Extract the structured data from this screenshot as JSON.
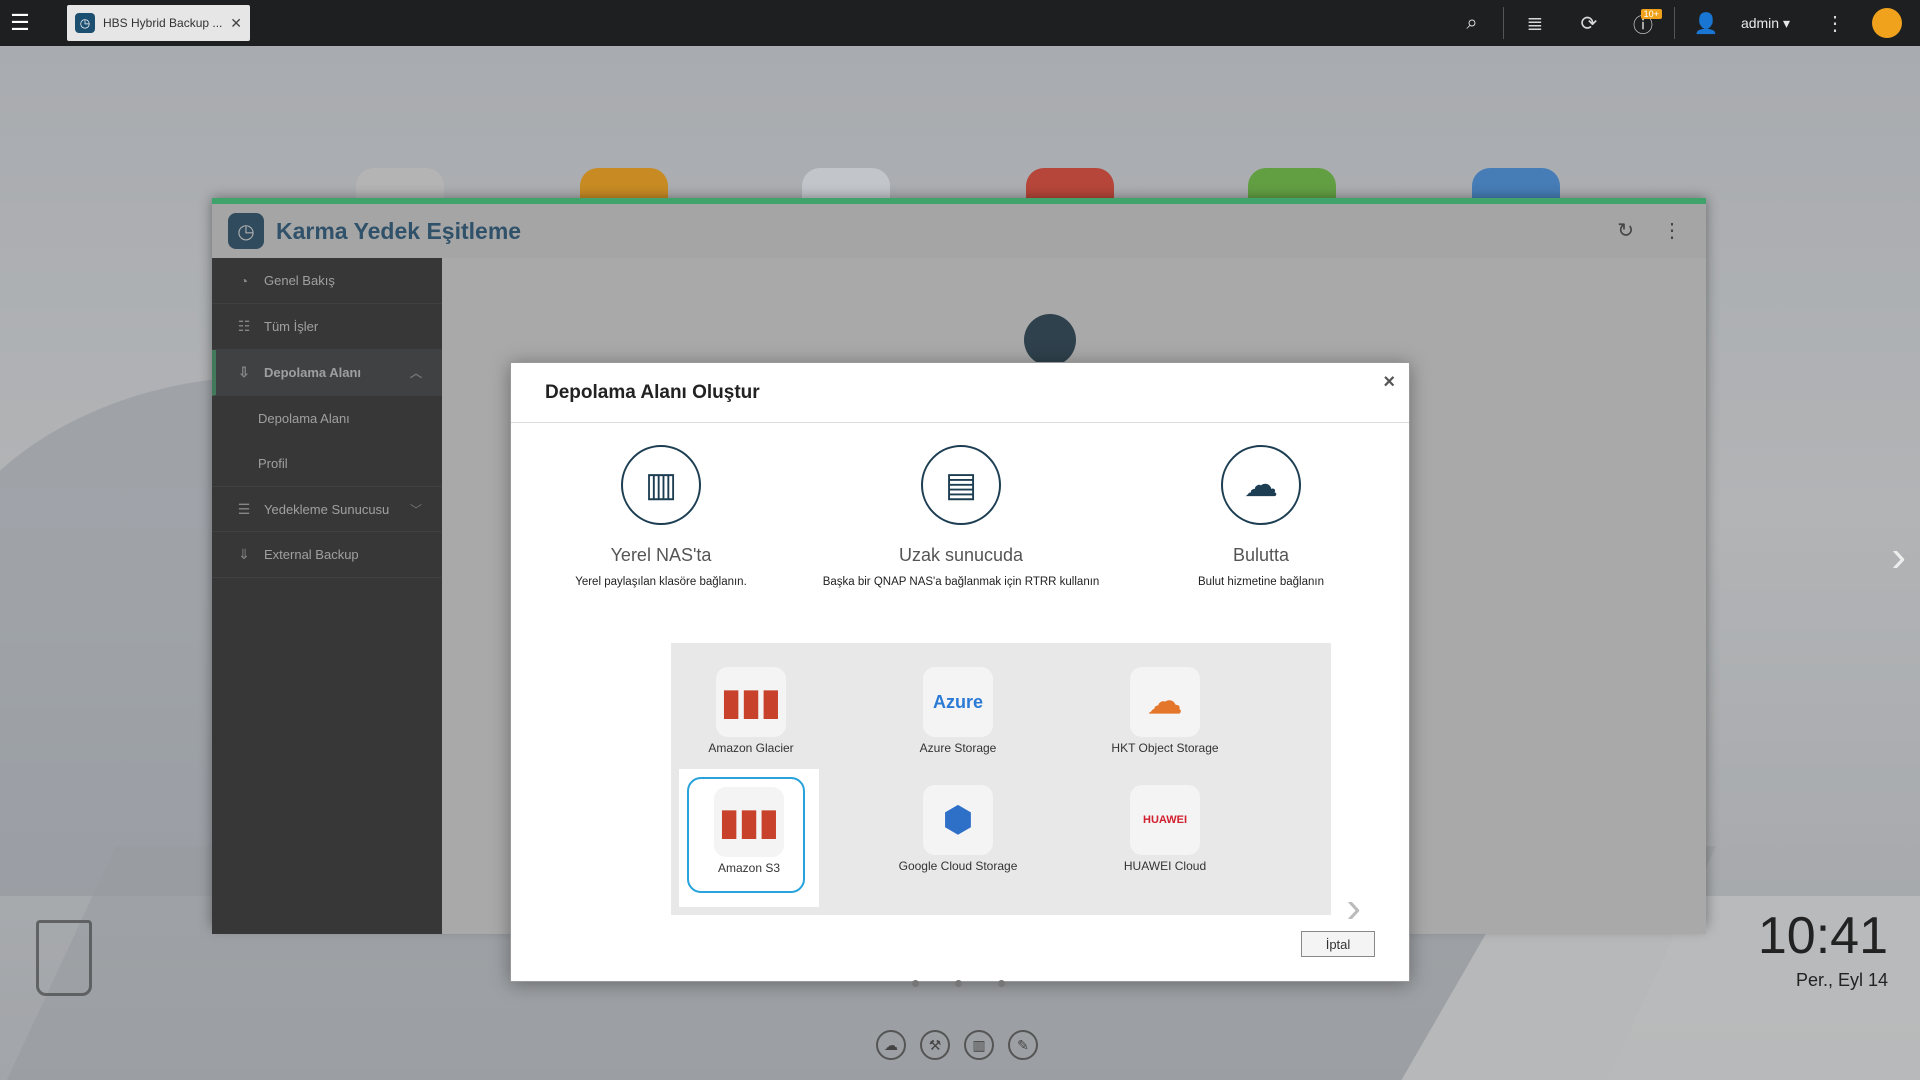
{
  "topbar": {
    "tab_title": "HBS Hybrid Backup ...",
    "user": "admin ▾",
    "notification_badge": "10+"
  },
  "app": {
    "title": "Karma Yedek Eşitleme",
    "sidebar": {
      "items": [
        {
          "label": "Genel Bakış"
        },
        {
          "label": "Tüm İşler"
        },
        {
          "label": "Depolama Alanı"
        },
        {
          "label": "Yedekleme Sunucusu"
        },
        {
          "label": "External Backup"
        }
      ],
      "subitems": [
        {
          "label": "Depolama Alanı"
        },
        {
          "label": "Profil"
        }
      ]
    }
  },
  "dialog": {
    "title": "Depolama Alanı Oluştur",
    "targets": [
      {
        "name": "Yerel NAS'ta",
        "desc": "Yerel paylaşılan klasöre bağlanın."
      },
      {
        "name": "Uzak sunucuda",
        "desc": "Başka bir QNAP NAS'a bağlanmak için RTRR kullanın"
      },
      {
        "name": "Bulutta",
        "desc": "Bulut hizmetine bağlanın"
      }
    ],
    "providers": [
      {
        "name": "Amazon Glacier"
      },
      {
        "name": "Azure Storage",
        "logo_text": "Azure"
      },
      {
        "name": "HKT Object Storage"
      },
      {
        "name": "Amazon S3"
      },
      {
        "name": "Google Cloud Storage"
      },
      {
        "name": "HUAWEI Cloud",
        "logo_text": "HUAWEI"
      }
    ],
    "cancel_label": "İptal"
  },
  "desktop": {
    "clock_time": "10:41",
    "clock_date": "Per., Eyl 14"
  },
  "colors": {
    "accent": "#3fa36b",
    "title_blue": "#1d5a86",
    "selection": "#27a2db"
  }
}
